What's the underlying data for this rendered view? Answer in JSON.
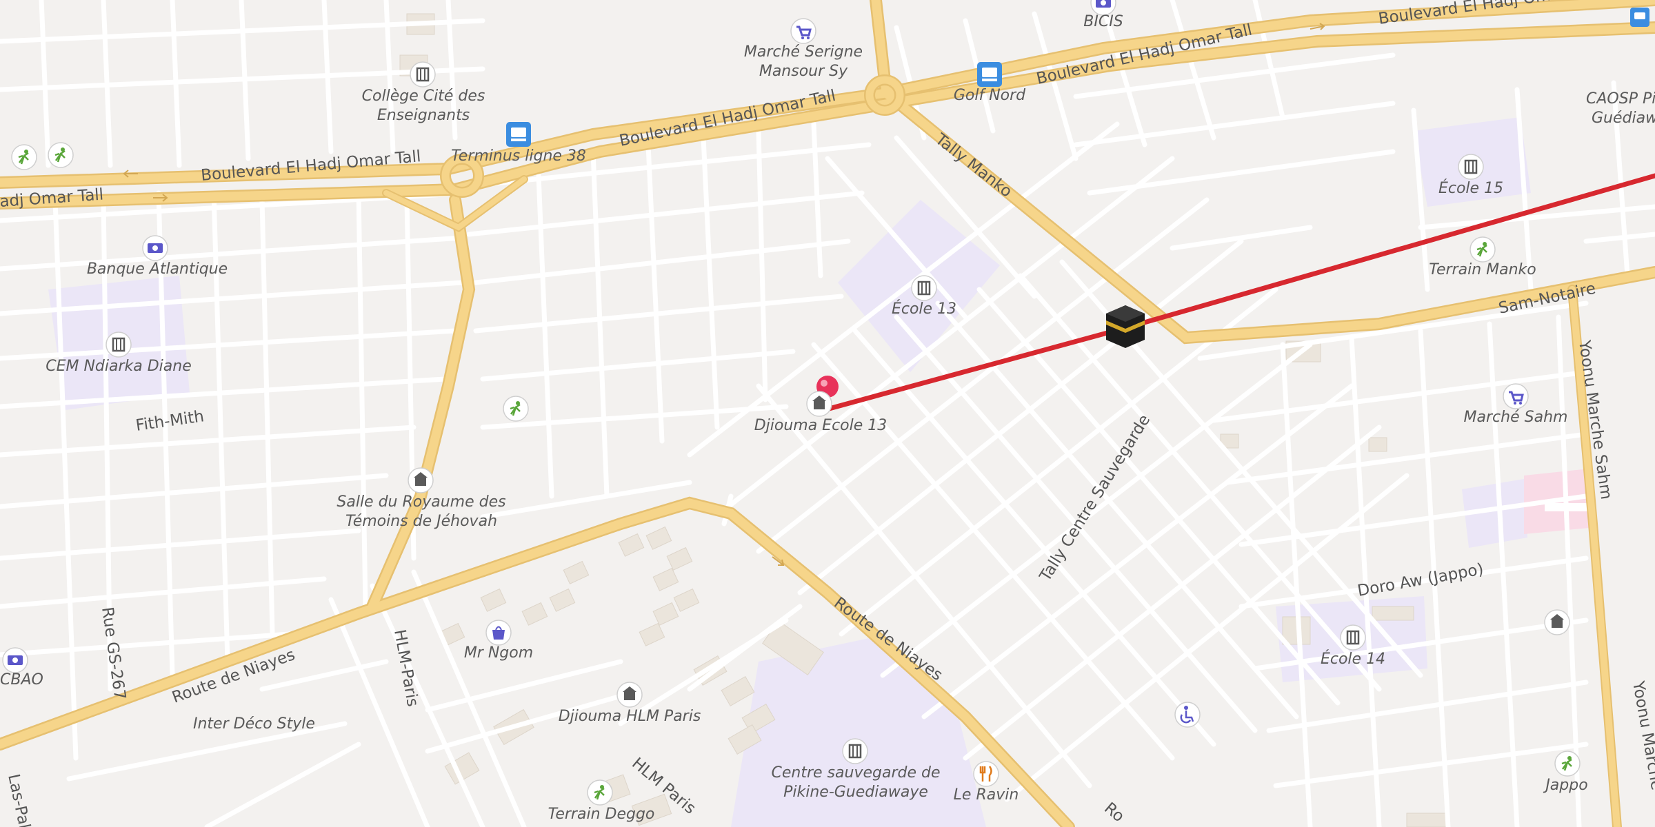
{
  "map": {
    "colors": {
      "background": "#f3f1ef",
      "minor_road": "#ffffff",
      "major_road": "#f6d58a",
      "major_road_casing": "#e6c070",
      "school_area": "#ebe6f7",
      "route_line": "#d7282f",
      "destination_pin": "#e8325a",
      "poi_school_icon": "#5a5a5a",
      "poi_bus_icon": "#3b8de0",
      "poi_shop_icon": "#5b57c9",
      "poi_sport_icon": "#5aa63a",
      "poi_restaurant_icon": "#e07b1c"
    },
    "road_labels": {
      "omar_tall_1": "Boulevard El Hadj Omar Tall",
      "omar_tall_2": "Boulevard El Hadj Omar Tall",
      "omar_tall_3": "Boulevard El Hadj Omar Tall",
      "omar_tall_4": "Boulevard El Hadj Omar Tall",
      "omar_tall_5": "adj Omar Tall",
      "tally_manko": "Tally Manko",
      "sam_notaire": "Sam-Notaire",
      "fith_mith": "Fith-Mith",
      "route_niayes_1": "Route de Niayes",
      "route_niayes_2": "Route de Niayes",
      "route_niayes_3": "Ro",
      "hlm_paris_1": "HLM-Paris",
      "hlm_paris_2": "HLM Paris",
      "rue_gs": "Rue GS-267",
      "las_pal": "Las-Pal",
      "tally_sauvegarde": "Tally Centre Sauvegarde",
      "doro_aw": "Doro Aw (Jappo)",
      "yoonu_sahm": "Yoonu Marche Sahm",
      "yoonu_marche": "Yoonu Marche"
    },
    "pois": [
      {
        "id": "bicis",
        "label": "BICIS",
        "icon": "bank-icon"
      },
      {
        "id": "marche-serigne",
        "label": "Marché Serigne\nMansour Sy",
        "icon": "shopping-cart-icon"
      },
      {
        "id": "college-cite",
        "label": "Collège Cité des\nEnseignants",
        "icon": "school-icon"
      },
      {
        "id": "terminus-38",
        "label": "Terminus ligne 38",
        "icon": "bus-icon"
      },
      {
        "id": "golf-nord",
        "label": "Golf Nord",
        "icon": "bus-icon"
      },
      {
        "id": "caosp",
        "label": "CAOSP Pi\nGuédiaw",
        "icon": "none"
      },
      {
        "id": "ecole-15",
        "label": "École 15",
        "icon": "school-icon"
      },
      {
        "id": "terrain-manko",
        "label": "Terrain Manko",
        "icon": "sport-icon"
      },
      {
        "id": "banque-atlantique",
        "label": "Banque Atlantique",
        "icon": "bank-icon"
      },
      {
        "id": "ecole-13",
        "label": "École 13",
        "icon": "school-icon"
      },
      {
        "id": "cem-ndiarka",
        "label": "CEM Ndiarka Diane",
        "icon": "school-icon"
      },
      {
        "id": "marche-sahm",
        "label": "Marché Sahm",
        "icon": "shopping-cart-icon"
      },
      {
        "id": "djiouma-ecole-13",
        "label": "Djiouma Ecole 13",
        "icon": "place-of-worship-icon"
      },
      {
        "id": "salle-royaume",
        "label": "Salle du Royaume des\nTémoins de Jéhovah",
        "icon": "place-of-worship-icon"
      },
      {
        "id": "mr-ngom",
        "label": "Mr Ngom",
        "icon": "shopping-bag-icon"
      },
      {
        "id": "cbao",
        "label": "CBAO",
        "icon": "bank-icon"
      },
      {
        "id": "inter-deco",
        "label": "Inter Déco Style",
        "icon": "none"
      },
      {
        "id": "djiouma-hlm",
        "label": "Djiouma HLM Paris",
        "icon": "place-of-worship-icon"
      },
      {
        "id": "terrain-deggo",
        "label": "Terrain Deggo",
        "icon": "sport-icon"
      },
      {
        "id": "centre-sauvegarde",
        "label": "Centre sauvegarde de\nPikine-Guediawaye",
        "icon": "school-icon"
      },
      {
        "id": "le-ravin",
        "label": "Le Ravin",
        "icon": "restaurant-icon"
      },
      {
        "id": "ecole-14",
        "label": "École 14",
        "icon": "school-icon"
      },
      {
        "id": "jappo",
        "label": "Jappo",
        "icon": "sport-icon"
      }
    ]
  }
}
